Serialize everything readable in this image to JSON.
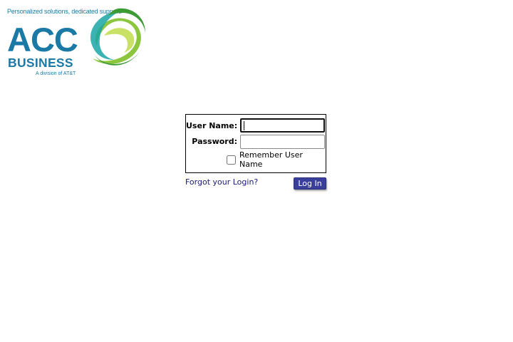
{
  "logo": {
    "tagline": "Personalized solutions, dedicated support.",
    "brand_top": "ACC",
    "brand_bottom": "BUSINESS",
    "division": "A division of AT&T",
    "colors": {
      "brand_blue": "#1b79a6",
      "swirl_green": "#8cc63f",
      "swirl_dark_green": "#3d9b35",
      "swirl_teal": "#1aa6a6"
    }
  },
  "login": {
    "username_label": "User Name:",
    "username_value": "",
    "password_label": "Password:",
    "password_value": "",
    "remember_label": "Remember User Name",
    "remember_checked": false,
    "forgot_link": "Forgot your Login?",
    "submit_label": "Log In",
    "colors": {
      "button_bg": "#3b3f9c",
      "link": "#1a1a7a"
    }
  }
}
